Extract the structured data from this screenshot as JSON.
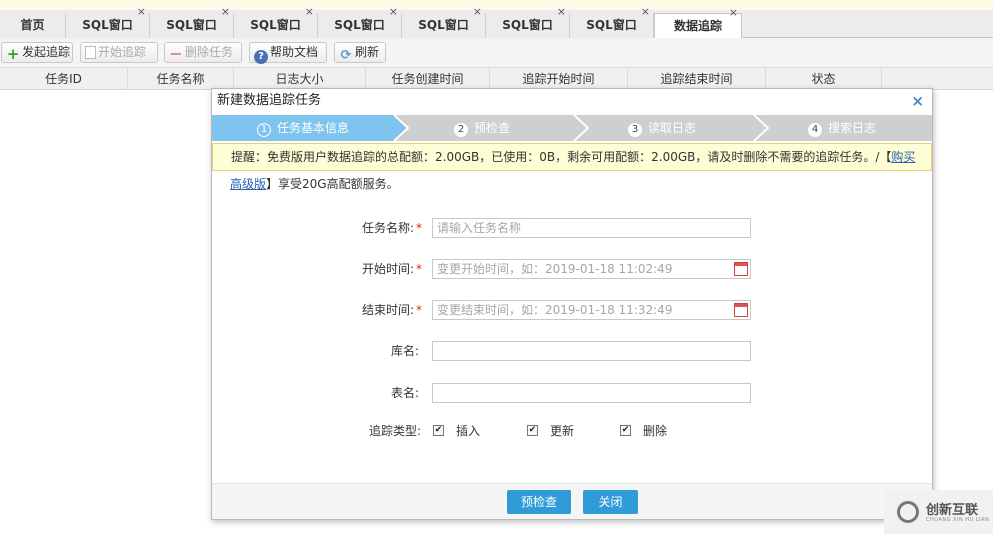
{
  "tabs": [
    {
      "label": "首页",
      "closable": false
    },
    {
      "label": "SQL窗口",
      "closable": true
    },
    {
      "label": "SQL窗口",
      "closable": true
    },
    {
      "label": "SQL窗口",
      "closable": true
    },
    {
      "label": "SQL窗口",
      "closable": true
    },
    {
      "label": "SQL窗口",
      "closable": true
    },
    {
      "label": "SQL窗口",
      "closable": true
    },
    {
      "label": "SQL窗口",
      "closable": true
    },
    {
      "label": "数据追踪",
      "closable": true,
      "active": true
    }
  ],
  "tab_close_glyph": "×",
  "toolbar": {
    "start_trace": "发起追踪",
    "begin_trace": "开始追踪",
    "delete_task": "删除任务",
    "help_doc": "帮助文档",
    "refresh": "刷新"
  },
  "grid_columns": [
    "任务ID",
    "任务名称",
    "日志大小",
    "任务创建时间",
    "追踪开始时间",
    "追踪结束时间",
    "状态"
  ],
  "modal": {
    "title": "新建数据追踪任务",
    "close_glyph": "×",
    "steps": [
      {
        "num": "1",
        "label": "任务基本信息",
        "active": true
      },
      {
        "num": "2",
        "label": "预检查",
        "active": false
      },
      {
        "num": "3",
        "label": "读取日志",
        "active": false
      },
      {
        "num": "4",
        "label": "搜索日志",
        "active": false
      }
    ],
    "warning": {
      "text": "提醒：免费版用户数据追踪的总配额：2.00GB，已使用：0B，剩余可用配额：2.00GB，请及时删除不需要的追踪任务。/【",
      "link_part1": "购买",
      "link_part2": "高级版",
      "suffix": "】享受20G高配额服务。"
    },
    "form": {
      "task_name_label": "任务名称:",
      "task_name_placeholder": "请输入任务名称",
      "start_time_label": "开始时间:",
      "start_time_placeholder": "变更开始时间，如：2019-01-18 11:02:49",
      "end_time_label": "结束时间:",
      "end_time_placeholder": "变更结束时间，如：2019-01-18 11:32:49",
      "db_label": "库名:",
      "table_label": "表名:",
      "trace_type_label": "追踪类型:",
      "required_mark": "*",
      "trace_types": [
        {
          "label": "插入",
          "checked": true
        },
        {
          "label": "更新",
          "checked": true
        },
        {
          "label": "删除",
          "checked": true
        }
      ]
    },
    "buttons": {
      "precheck": "预检查",
      "close": "关闭"
    }
  },
  "watermark": {
    "name": "创新互联",
    "sub": "CHUANG XIN HU LIAN"
  },
  "colors": {
    "accent": "#2f9cd8",
    "step_active": "#7ec4ee",
    "step_inactive": "#cfcfcf",
    "warning_bg": "#fdfdd6",
    "required": "#d9261c"
  }
}
